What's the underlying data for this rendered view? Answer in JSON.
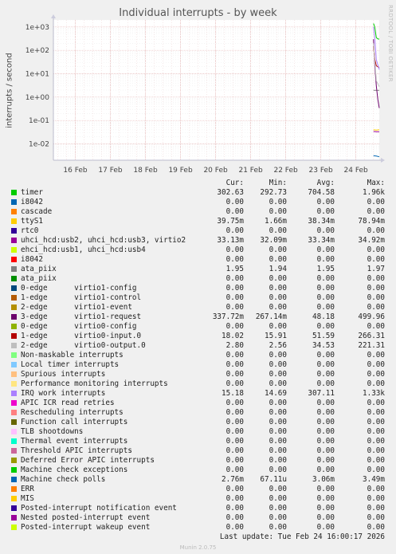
{
  "chart_data": {
    "type": "line",
    "title": "Individual interrupts - by week",
    "ylabel": "interrupts / second",
    "yscale": "log",
    "ylim": [
      0.002,
      2000
    ],
    "y_ticks": [
      0.01,
      0.1,
      1,
      10,
      100,
      1000
    ],
    "y_tick_labels": [
      "1e-02",
      "1e-01",
      "1e+00",
      "1e+01",
      "1e+02",
      "1e+03"
    ],
    "x_tick_labels": [
      "16 Feb",
      "17 Feb",
      "18 Feb",
      "19 Feb",
      "20 Feb",
      "21 Feb",
      "22 Feb",
      "23 Feb",
      "24 Feb"
    ],
    "x_range": [
      "2026-02-15T09:00",
      "2026-02-24T16:00"
    ],
    "grid": true,
    "side_label": "RRDTOOL / TOBI OETIKER",
    "columns": [
      "Cur:",
      "Min:",
      "Avg:",
      "Max:"
    ],
    "series": [
      {
        "name": "timer",
        "color": "#00cc00",
        "cur": "302.63",
        "min": "292.73",
        "avg": "704.58",
        "max": "1.96k",
        "points": [
          [
            "2026-02-24T12:00",
            1400
          ],
          [
            "2026-02-24T12:30",
            1200
          ],
          [
            "2026-02-24T13:00",
            900
          ],
          [
            "2026-02-24T14:00",
            350
          ],
          [
            "2026-02-24T15:00",
            310
          ],
          [
            "2026-02-24T16:00",
            302
          ]
        ]
      },
      {
        "name": "i8042",
        "color": "#0066b3",
        "cur": "0.00",
        "min": "0.00",
        "avg": "0.00",
        "max": "0.00"
      },
      {
        "name": "cascade",
        "color": "#ff8000",
        "cur": "0.00",
        "min": "0.00",
        "avg": "0.00",
        "max": "0.00"
      },
      {
        "name": "ttyS1",
        "color": "#ffcc00",
        "cur": "39.75m",
        "min": "1.66m",
        "avg": "38.34m",
        "max": "78.94m",
        "points": [
          [
            "2026-02-24T12:00",
            0.04
          ],
          [
            "2026-02-24T14:00",
            0.039
          ],
          [
            "2026-02-24T16:00",
            0.04
          ]
        ]
      },
      {
        "name": "rtc0",
        "color": "#330099",
        "cur": "0.00",
        "min": "0.00",
        "avg": "0.00",
        "max": "0.00"
      },
      {
        "name": "uhci_hcd:usb2, uhci_hcd:usb3, virtio2",
        "color": "#990099",
        "cur": "33.13m",
        "min": "32.09m",
        "avg": "33.34m",
        "max": "34.92m",
        "points": [
          [
            "2026-02-24T12:00",
            0.034
          ],
          [
            "2026-02-24T14:00",
            0.033
          ],
          [
            "2026-02-24T16:00",
            0.033
          ]
        ]
      },
      {
        "name": "ehci_hcd:usb1, uhci_hcd:usb4",
        "color": "#ccff00",
        "cur": "0.00",
        "min": "0.00",
        "avg": "0.00",
        "max": "0.00"
      },
      {
        "name": "i8042",
        "color": "#ff0000",
        "cur": "0.00",
        "min": "0.00",
        "avg": "0.00",
        "max": "0.00"
      },
      {
        "name": "ata_piix",
        "color": "#808080",
        "cur": "1.95",
        "min": "1.94",
        "avg": "1.95",
        "max": "1.97",
        "points": [
          [
            "2026-02-24T12:00",
            1.95
          ],
          [
            "2026-02-24T16:00",
            1.95
          ]
        ]
      },
      {
        "name": "ata_piix",
        "color": "#008f00",
        "cur": "0.00",
        "min": "0.00",
        "avg": "0.00",
        "max": "0.00"
      },
      {
        "name": "0-edge      virtio1-config",
        "color": "#00487d",
        "cur": "0.00",
        "min": "0.00",
        "avg": "0.00",
        "max": "0.00"
      },
      {
        "name": "1-edge      virtio1-control",
        "color": "#b35a00",
        "cur": "0.00",
        "min": "0.00",
        "avg": "0.00",
        "max": "0.00"
      },
      {
        "name": "2-edge      virtio1-event",
        "color": "#b38f00",
        "cur": "0.00",
        "min": "0.00",
        "avg": "0.00",
        "max": "0.00"
      },
      {
        "name": "3-edge      virtio1-request",
        "color": "#6b006b",
        "cur": "337.72m",
        "min": "267.14m",
        "avg": "48.18",
        "max": "499.96",
        "points": [
          [
            "2026-02-24T12:00",
            300
          ],
          [
            "2026-02-24T12:30",
            80
          ],
          [
            "2026-02-24T13:00",
            20
          ],
          [
            "2026-02-24T14:00",
            3
          ],
          [
            "2026-02-24T15:00",
            0.8
          ],
          [
            "2026-02-24T16:00",
            0.34
          ]
        ]
      },
      {
        "name": "0-edge      virtio0-config",
        "color": "#8fb300",
        "cur": "0.00",
        "min": "0.00",
        "avg": "0.00",
        "max": "0.00"
      },
      {
        "name": "1-edge      virtio0-input.0",
        "color": "#b30000",
        "cur": "18.02",
        "min": "15.91",
        "avg": "51.59",
        "max": "266.31",
        "points": [
          [
            "2026-02-24T12:00",
            150
          ],
          [
            "2026-02-24T13:00",
            40
          ],
          [
            "2026-02-24T14:00",
            22
          ],
          [
            "2026-02-24T16:00",
            18
          ]
        ]
      },
      {
        "name": "2-edge      virtio0-output.0",
        "color": "#bebebe",
        "cur": "2.80",
        "min": "2.56",
        "avg": "34.53",
        "max": "221.31",
        "points": [
          [
            "2026-02-24T12:00",
            200
          ],
          [
            "2026-02-24T13:00",
            30
          ],
          [
            "2026-02-24T14:00",
            5
          ],
          [
            "2026-02-24T16:00",
            2.8
          ]
        ]
      },
      {
        "name": "Non-maskable interrupts",
        "color": "#80ff80",
        "cur": "0.00",
        "min": "0.00",
        "avg": "0.00",
        "max": "0.00"
      },
      {
        "name": "Local timer interrupts",
        "color": "#80c9ff",
        "cur": "0.00",
        "min": "0.00",
        "avg": "0.00",
        "max": "0.00"
      },
      {
        "name": "Spurious interrupts",
        "color": "#ffc080",
        "cur": "0.00",
        "min": "0.00",
        "avg": "0.00",
        "max": "0.00"
      },
      {
        "name": "Performance monitoring interrupts",
        "color": "#ffe680",
        "cur": "0.00",
        "min": "0.00",
        "avg": "0.00",
        "max": "0.00"
      },
      {
        "name": "IRQ work interrupts",
        "color": "#aa80ff",
        "cur": "15.18",
        "min": "14.69",
        "avg": "307.11",
        "max": "1.33k",
        "points": [
          [
            "2026-02-24T12:00",
            1000
          ],
          [
            "2026-02-24T13:00",
            300
          ],
          [
            "2026-02-24T14:00",
            40
          ],
          [
            "2026-02-24T16:00",
            15
          ]
        ]
      },
      {
        "name": "APIC ICR read retries",
        "color": "#ee00cc",
        "cur": "0.00",
        "min": "0.00",
        "avg": "0.00",
        "max": "0.00"
      },
      {
        "name": "Rescheduling interrupts",
        "color": "#ff8080",
        "cur": "0.00",
        "min": "0.00",
        "avg": "0.00",
        "max": "0.00"
      },
      {
        "name": "Function call interrupts",
        "color": "#666600",
        "cur": "0.00",
        "min": "0.00",
        "avg": "0.00",
        "max": "0.00"
      },
      {
        "name": "TLB shootdowns",
        "color": "#ffbfff",
        "cur": "0.00",
        "min": "0.00",
        "avg": "0.00",
        "max": "0.00"
      },
      {
        "name": "Thermal event interrupts",
        "color": "#00ffcc",
        "cur": "0.00",
        "min": "0.00",
        "avg": "0.00",
        "max": "0.00"
      },
      {
        "name": "Threshold APIC interrupts",
        "color": "#cc6699",
        "cur": "0.00",
        "min": "0.00",
        "avg": "0.00",
        "max": "0.00"
      },
      {
        "name": "Deferred Error APIC interrupts",
        "color": "#999900",
        "cur": "0.00",
        "min": "0.00",
        "avg": "0.00",
        "max": "0.00"
      },
      {
        "name": "Machine check exceptions",
        "color": "#00cc00",
        "cur": "0.00",
        "min": "0.00",
        "avg": "0.00",
        "max": "0.00"
      },
      {
        "name": "Machine check polls",
        "color": "#0066b3",
        "cur": "2.76m",
        "min": "67.11u",
        "avg": "3.06m",
        "max": "3.49m",
        "points": [
          [
            "2026-02-24T12:00",
            0.0031
          ],
          [
            "2026-02-24T14:00",
            0.003
          ],
          [
            "2026-02-24T16:00",
            0.0028
          ]
        ]
      },
      {
        "name": "ERR",
        "color": "#ff8000",
        "cur": "0.00",
        "min": "0.00",
        "avg": "0.00",
        "max": "0.00"
      },
      {
        "name": "MIS",
        "color": "#ffcc00",
        "cur": "0.00",
        "min": "0.00",
        "avg": "0.00",
        "max": "0.00"
      },
      {
        "name": "Posted-interrupt notification event",
        "color": "#330099",
        "cur": "0.00",
        "min": "0.00",
        "avg": "0.00",
        "max": "0.00"
      },
      {
        "name": "Nested posted-interrupt event",
        "color": "#990099",
        "cur": "0.00",
        "min": "0.00",
        "avg": "0.00",
        "max": "0.00"
      },
      {
        "name": "Posted-interrupt wakeup event",
        "color": "#ccff00",
        "cur": "0.00",
        "min": "0.00",
        "avg": "0.00",
        "max": "0.00"
      }
    ]
  },
  "last_update": "Last update: Tue Feb 24 16:00:17 2026",
  "footer": "Munin 2.0.75"
}
